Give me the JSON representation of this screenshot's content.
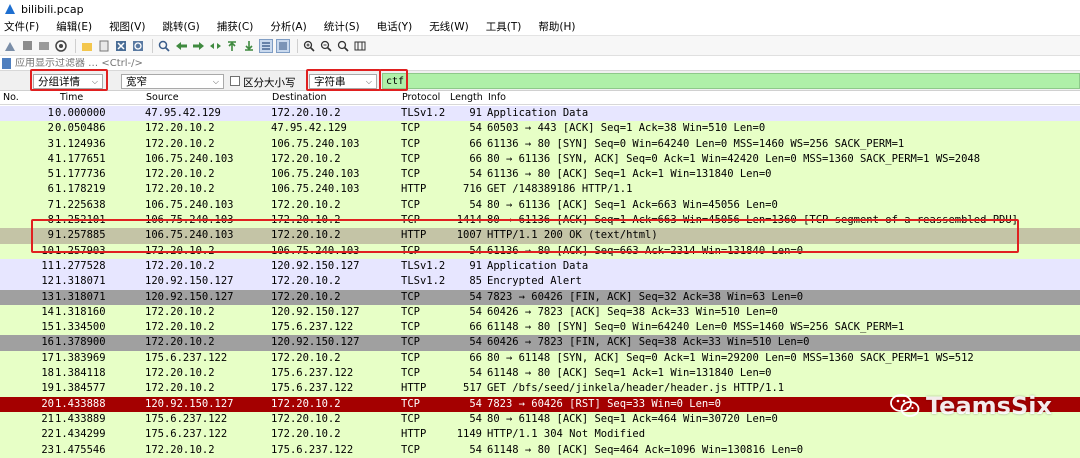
{
  "window": {
    "title": "bilibili.pcap"
  },
  "menu": [
    "文件(F)",
    "编辑(E)",
    "视图(V)",
    "跳转(G)",
    "捕获(C)",
    "分析(A)",
    "统计(S)",
    "电话(Y)",
    "无线(W)",
    "工具(T)",
    "帮助(H)"
  ],
  "toolbar_icons": [
    "shark-fin-start-icon",
    "stop-icon",
    "restart-icon",
    "options-icon",
    "open-file-icon",
    "save-icon",
    "close-file-icon",
    "reload-icon",
    "find-icon",
    "go-back-icon",
    "go-forward-icon",
    "go-to-packet-icon",
    "first-packet-icon",
    "last-packet-icon",
    "autoscroll-icon",
    "colorize-icon",
    "zoom-in-icon",
    "zoom-out-icon",
    "zoom-normal-icon",
    "resize-columns-icon"
  ],
  "display_filter": {
    "placeholder": "应用显示过滤器 … <Ctrl-/>"
  },
  "find": {
    "scope": "分组详情",
    "charset": "宽窄",
    "case_label": "区分大小写",
    "type": "字符串",
    "query": "ctf"
  },
  "columns": {
    "no": "No.",
    "time": "Time",
    "source": "Source",
    "destination": "Destination",
    "protocol": "Protocol",
    "length": "Length",
    "info": "Info"
  },
  "colors": {
    "tls_bg": "#e7e6ff",
    "tcp_bg": "#e7ffc6",
    "gray_bg": "#a0a0a0",
    "selected_bg": "#c4c4a6",
    "rst_bg": "#a40000",
    "find_bg": "#aff0a8",
    "highlight": "#e02020"
  },
  "packets": [
    {
      "no": "1",
      "time": "0.000000",
      "src": "47.95.42.129",
      "dst": "172.20.10.2",
      "proto": "TLSv1.2",
      "len": "91",
      "info": "Application Data",
      "style": "tls"
    },
    {
      "no": "2",
      "time": "0.050486",
      "src": "172.20.10.2",
      "dst": "47.95.42.129",
      "proto": "TCP",
      "len": "54",
      "info": "60503 → 443 [ACK] Seq=1 Ack=38 Win=510 Len=0",
      "style": "tcp"
    },
    {
      "no": "3",
      "time": "1.124936",
      "src": "172.20.10.2",
      "dst": "106.75.240.103",
      "proto": "TCP",
      "len": "66",
      "info": "61136 → 80 [SYN] Seq=0 Win=64240 Len=0 MSS=1460 WS=256 SACK_PERM=1",
      "style": "tcp"
    },
    {
      "no": "4",
      "time": "1.177651",
      "src": "106.75.240.103",
      "dst": "172.20.10.2",
      "proto": "TCP",
      "len": "66",
      "info": "80 → 61136 [SYN, ACK] Seq=0 Ack=1 Win=42420 Len=0 MSS=1360 SACK_PERM=1 WS=2048",
      "style": "tcp"
    },
    {
      "no": "5",
      "time": "1.177736",
      "src": "172.20.10.2",
      "dst": "106.75.240.103",
      "proto": "TCP",
      "len": "54",
      "info": "61136 → 80 [ACK] Seq=1 Ack=1 Win=131840 Len=0",
      "style": "tcp"
    },
    {
      "no": "6",
      "time": "1.178219",
      "src": "172.20.10.2",
      "dst": "106.75.240.103",
      "proto": "HTTP",
      "len": "716",
      "info": "GET /148389186 HTTP/1.1",
      "style": "tcp"
    },
    {
      "no": "7",
      "time": "1.225638",
      "src": "106.75.240.103",
      "dst": "172.20.10.2",
      "proto": "TCP",
      "len": "54",
      "info": "80 → 61136 [ACK] Seq=1 Ack=663 Win=45056 Len=0",
      "style": "tcp"
    },
    {
      "no": "8",
      "time": "1.252101",
      "src": "106.75.240.103",
      "dst": "172.20.10.2",
      "proto": "TCP",
      "len": "1414",
      "info": "80 → 61136 [ACK] Seq=1 Ack=663 Win=45056 Len=1360 [TCP segment of a reassembled PDU]",
      "style": "tcp"
    },
    {
      "no": "9",
      "time": "1.257885",
      "src": "106.75.240.103",
      "dst": "172.20.10.2",
      "proto": "HTTP",
      "len": "1007",
      "info": "HTTP/1.1 200 OK  (text/html)",
      "style": "selected"
    },
    {
      "no": "10",
      "time": "1.257903",
      "src": "172.20.10.2",
      "dst": "106.75.240.103",
      "proto": "TCP",
      "len": "54",
      "info": "61136 → 80 [ACK] Seq=663 Ack=2314 Win=131840 Len=0",
      "style": "tcp"
    },
    {
      "no": "11",
      "time": "1.277528",
      "src": "172.20.10.2",
      "dst": "120.92.150.127",
      "proto": "TLSv1.2",
      "len": "91",
      "info": "Application Data",
      "style": "tls"
    },
    {
      "no": "12",
      "time": "1.318071",
      "src": "120.92.150.127",
      "dst": "172.20.10.2",
      "proto": "TLSv1.2",
      "len": "85",
      "info": "Encrypted Alert",
      "style": "tls"
    },
    {
      "no": "13",
      "time": "1.318071",
      "src": "120.92.150.127",
      "dst": "172.20.10.2",
      "proto": "TCP",
      "len": "54",
      "info": "7823 → 60426 [FIN, ACK] Seq=32 Ack=38 Win=63 Len=0",
      "style": "gray"
    },
    {
      "no": "14",
      "time": "1.318160",
      "src": "172.20.10.2",
      "dst": "120.92.150.127",
      "proto": "TCP",
      "len": "54",
      "info": "60426 → 7823 [ACK] Seq=38 Ack=33 Win=510 Len=0",
      "style": "tcp"
    },
    {
      "no": "15",
      "time": "1.334500",
      "src": "172.20.10.2",
      "dst": "175.6.237.122",
      "proto": "TCP",
      "len": "66",
      "info": "61148 → 80 [SYN] Seq=0 Win=64240 Len=0 MSS=1460 WS=256 SACK_PERM=1",
      "style": "tcp"
    },
    {
      "no": "16",
      "time": "1.378900",
      "src": "172.20.10.2",
      "dst": "120.92.150.127",
      "proto": "TCP",
      "len": "54",
      "info": "60426 → 7823 [FIN, ACK] Seq=38 Ack=33 Win=510 Len=0",
      "style": "gray"
    },
    {
      "no": "17",
      "time": "1.383969",
      "src": "175.6.237.122",
      "dst": "172.20.10.2",
      "proto": "TCP",
      "len": "66",
      "info": "80 → 61148 [SYN, ACK] Seq=0 Ack=1 Win=29200 Len=0 MSS=1360 SACK_PERM=1 WS=512",
      "style": "tcp"
    },
    {
      "no": "18",
      "time": "1.384118",
      "src": "172.20.10.2",
      "dst": "175.6.237.122",
      "proto": "TCP",
      "len": "54",
      "info": "61148 → 80 [ACK] Seq=1 Ack=1 Win=131840 Len=0",
      "style": "tcp"
    },
    {
      "no": "19",
      "time": "1.384577",
      "src": "172.20.10.2",
      "dst": "175.6.237.122",
      "proto": "HTTP",
      "len": "517",
      "info": "GET /bfs/seed/jinkela/header/header.js HTTP/1.1",
      "style": "tcp"
    },
    {
      "no": "20",
      "time": "1.433888",
      "src": "120.92.150.127",
      "dst": "172.20.10.2",
      "proto": "TCP",
      "len": "54",
      "info": "7823 → 60426 [RST] Seq=33 Win=0 Len=0",
      "style": "rst"
    },
    {
      "no": "21",
      "time": "1.433889",
      "src": "175.6.237.122",
      "dst": "172.20.10.2",
      "proto": "TCP",
      "len": "54",
      "info": "80 → 61148 [ACK] Seq=1 Ack=464 Win=30720 Len=0",
      "style": "tcp"
    },
    {
      "no": "22",
      "time": "1.434299",
      "src": "175.6.237.122",
      "dst": "172.20.10.2",
      "proto": "HTTP",
      "len": "1149",
      "info": "HTTP/1.1 304 Not Modified",
      "style": "tcp"
    },
    {
      "no": "23",
      "time": "1.475546",
      "src": "172.20.10.2",
      "dst": "175.6.237.122",
      "proto": "TCP",
      "len": "54",
      "info": "61148 → 80 [ACK] Seq=464 Ack=1096 Win=130816 Len=0",
      "style": "tcp"
    }
  ],
  "watermark": {
    "text": "TeamsSix"
  }
}
